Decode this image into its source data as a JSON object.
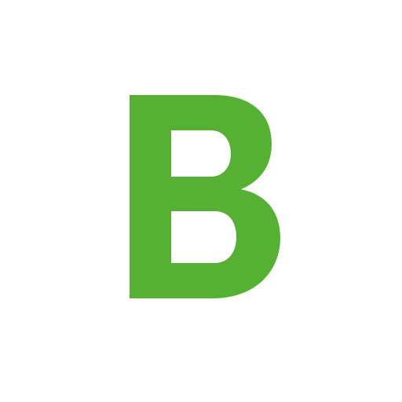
{
  "logo": {
    "name": "letter-b-logo",
    "letter": "B",
    "color": "#56b034"
  },
  "background": {
    "color": "#ffffff"
  }
}
